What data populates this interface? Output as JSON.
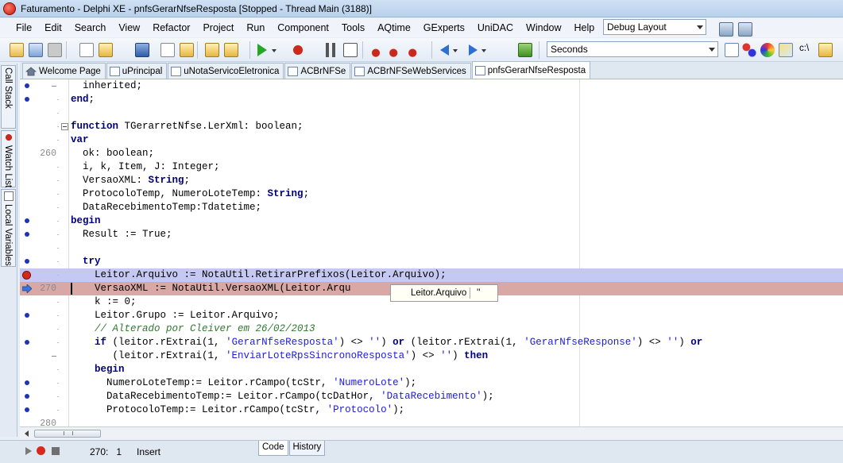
{
  "window": {
    "title": "Faturamento - Delphi XE - pnfsGerarNfseResposta [Stopped - Thread Main (3188)]"
  },
  "menu": [
    "File",
    "Edit",
    "Search",
    "View",
    "Refactor",
    "Project",
    "Run",
    "Component",
    "Tools",
    "AQtime",
    "GExperts",
    "UniDAC",
    "Window",
    "Help"
  ],
  "toolbar": {
    "layout_combo": "Debug Layout",
    "search_combo": "Seconds",
    "path_label": "c:\\"
  },
  "tabs": [
    "Welcome Page",
    "uPrincipal",
    "uNotaServicoEletronica",
    "ACBrNFSe",
    "ACBrNFSeWebServices",
    "pnfsGerarNfseResposta"
  ],
  "active_tab": 5,
  "dock": {
    "call_stack": "Call Stack",
    "watch_list": "Watch List",
    "local_variables": "Local Variables"
  },
  "editor": {
    "line_numbers": {
      "l260": "260",
      "l270": "270",
      "l280": "280"
    },
    "code": {
      "c1": "  inherited;",
      "c2_kw": "end",
      "c2_rest": ";",
      "c4_kw": "function",
      "c4_rest": " TGerarretNfse.LerXml: boolean;",
      "c5_kw": "var",
      "c6": "  ok: boolean;",
      "c7": "  i, k, Item, J: Integer;",
      "c8_a": "  VersaoXML: ",
      "c8_kw": "String",
      "c8_b": ";",
      "c9_a": "  ProtocoloTemp, NumeroLoteTemp: ",
      "c9_kw": "String",
      "c9_b": ";",
      "c10": "  DataRecebimentoTemp:Tdatetime;",
      "c11_kw": "begin",
      "c12": "  Result := True;",
      "c14_kw": "try",
      "c15": "    Leitor.Arquivo := NotaUtil.RetirarPrefixos(Leitor.Arquivo);",
      "c16": "    VersaoXML := NotaUtil.VersaoXML(Leitor.Arqu",
      "c17": "    k := 0;",
      "c18": "    Leitor.Grupo := Leitor.Arquivo;",
      "c19": "    // Alterado por Cleiver em 26/02/2013",
      "c20_a": "if",
      "c20_b": " (leitor.rExtrai(1, ",
      "c20_s1": "'GerarNfseResposta'",
      "c20_c": ") <> ",
      "c20_s2": "''",
      "c20_d": ") ",
      "c20_or1": "or",
      "c20_e": " (leitor.rExtrai(1, ",
      "c20_s3": "'GerarNfseResponse'",
      "c20_f": ") <> ",
      "c20_s4": "''",
      "c20_g": ") ",
      "c20_or2": "or",
      "c21_a": "(leitor.rExtrai(1, ",
      "c21_s1": "'EnviarLoteRpsSincronoResposta'",
      "c21_b": ") <> ",
      "c21_s2": "''",
      "c21_c": ") ",
      "c21_kw": "then",
      "c22_kw": "begin",
      "c23_a": "NumeroLoteTemp:= Leitor.rCampo(tcStr, ",
      "c23_s": "'NumeroLote'",
      "c23_b": ");",
      "c24_a": "DataRecebimentoTemp:= Leitor.rCampo(tcDatHor, ",
      "c24_s": "'DataRecebimento'",
      "c24_b": ");",
      "c25_a": "ProtocoloTemp:= Leitor.rCampo(tcStr, ",
      "c25_s": "'Protocolo'",
      "c25_b": ");"
    },
    "hint": {
      "name": "Leitor.Arquivo",
      "value": "''"
    }
  },
  "status": {
    "position": "270:   1",
    "mode": "Insert",
    "tabs": [
      "Code",
      "History"
    ]
  }
}
